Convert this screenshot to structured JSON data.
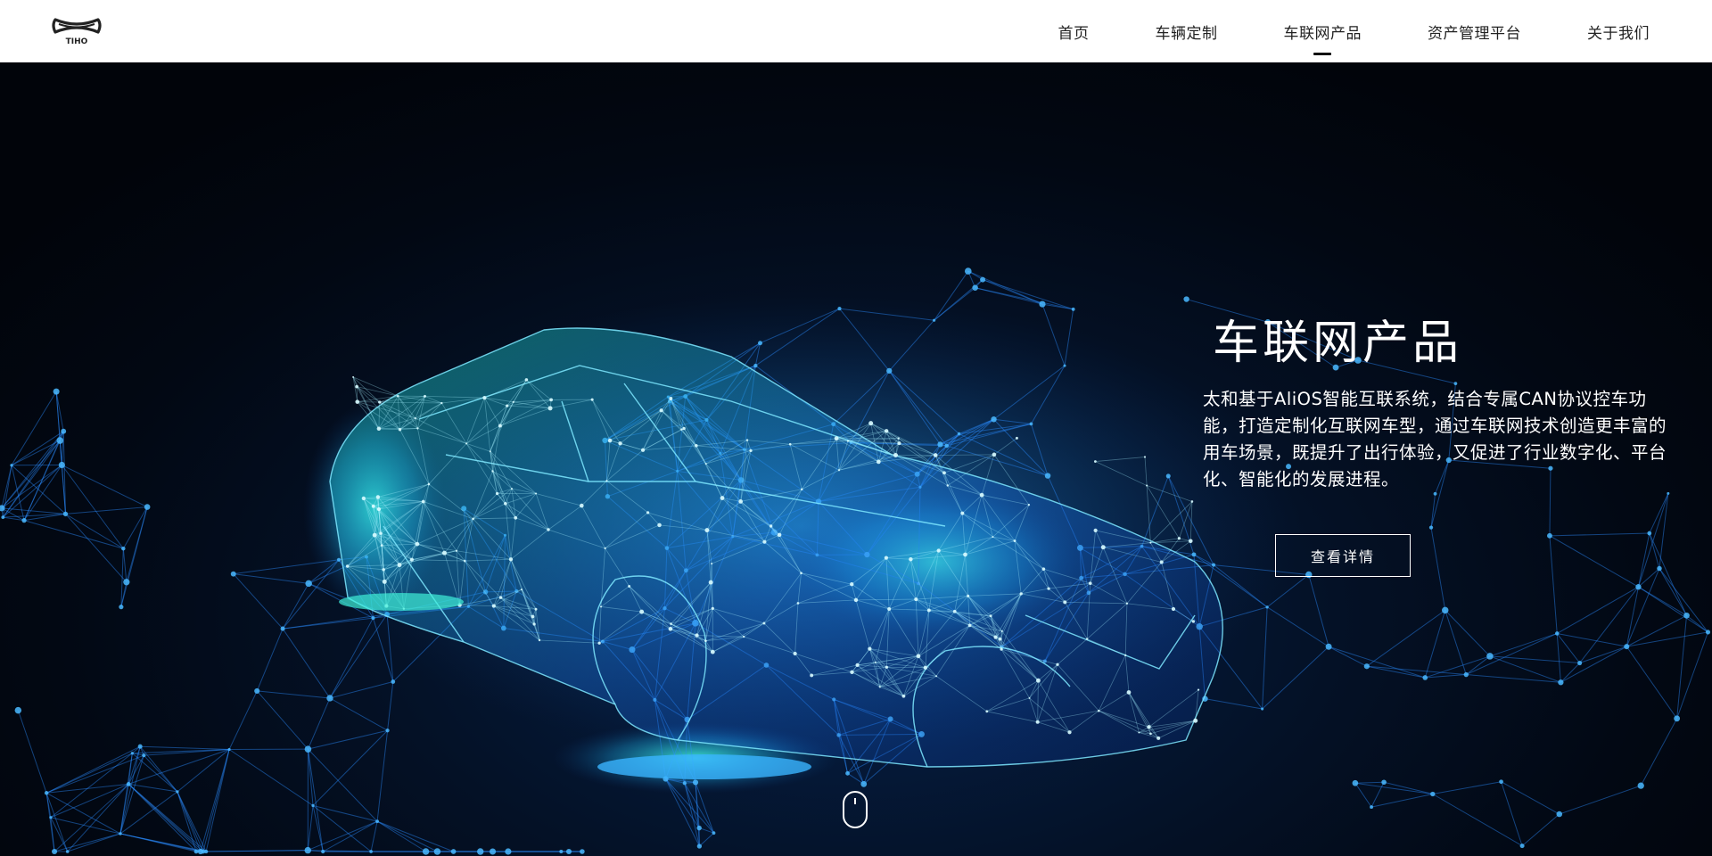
{
  "header": {
    "logo_text": "TIHO",
    "nav": [
      {
        "label": "首页",
        "active": false
      },
      {
        "label": "车辆定制",
        "active": false
      },
      {
        "label": "车联网产品",
        "active": true
      },
      {
        "label": "资产管理平台",
        "active": false
      },
      {
        "label": "关于我们",
        "active": false
      }
    ]
  },
  "hero": {
    "title": "车联网产品",
    "description": "太和基于AliOS智能互联系统，结合专属CAN协议控车功能，打造定制化互联网车型，通过车联网技术创造更丰富的用车场景，既提升了出行体验，又促进了行业数字化、平台化、智能化的发展进程。",
    "button_label": "查看详情",
    "scroll_icon": "mouse-scroll-icon",
    "background_image": "wireframe-car-image"
  },
  "colors": {
    "header_bg": "#ffffff",
    "hero_bg": "#020b1a",
    "accent_glow": "#1fe0c8",
    "mesh_blue": "#2a8cff"
  }
}
